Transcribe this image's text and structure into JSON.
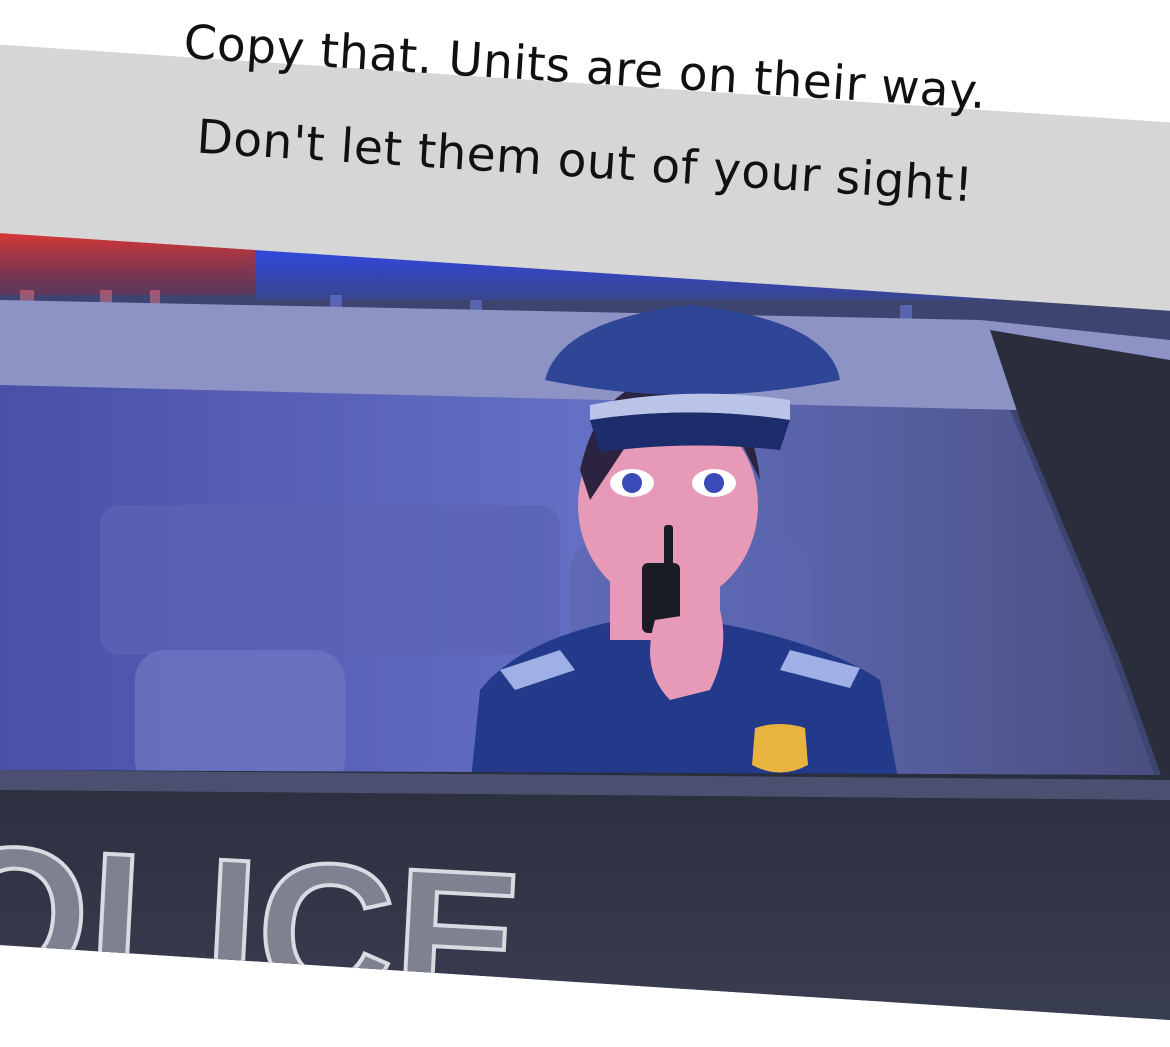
{
  "caption": {
    "line1": "Copy that. Units are on their way.",
    "line2": "Don't let them out of your sight!"
  },
  "scene": {
    "hood_lettering": "OLICE",
    "colors": {
      "caption_band": "#d6d6d6",
      "siren_red": "#e8302a",
      "siren_blue": "#2f4fe8",
      "car_body": "#1f2330",
      "interior": "#5a63b8",
      "uniform": "#233a8a",
      "skin": "#e79ab8",
      "badge": "#e9b340"
    }
  }
}
